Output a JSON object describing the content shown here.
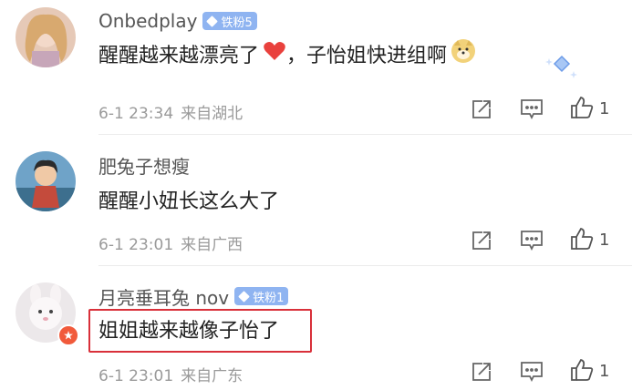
{
  "comments": [
    {
      "username": "Onbedplay",
      "badge": "铁粉5",
      "content": "醒醒越来越漂亮了",
      "content_tail": "，子怡姐快进组啊",
      "date": "6-1 23:34",
      "location": "来自湖北",
      "likes": "1",
      "avatar_icon": "blonde-girl-avatar"
    },
    {
      "username": "肥兔子想瘦",
      "badge": "",
      "content": "醒醒小妞长这么大了",
      "date": "6-1 23:01",
      "location": "来自广西",
      "likes": "1",
      "avatar_icon": "cartoon-girl-avatar"
    },
    {
      "username": "月亮垂耳兔 nov",
      "badge": "铁粉1",
      "content": "姐姐越来越像子怡了",
      "date": "6-1 23:01",
      "location": "来自广东",
      "likes": "1",
      "avatar_icon": "white-bunny-avatar"
    }
  ],
  "colors": {
    "badge": "#8fb4f1",
    "highlight": "#d9303a",
    "meta": "#9a9a9a"
  },
  "icons": [
    "share-icon",
    "comment-icon",
    "thumbs-up-icon",
    "heart-emoji",
    "doge-emoji",
    "sparkle-icon"
  ]
}
